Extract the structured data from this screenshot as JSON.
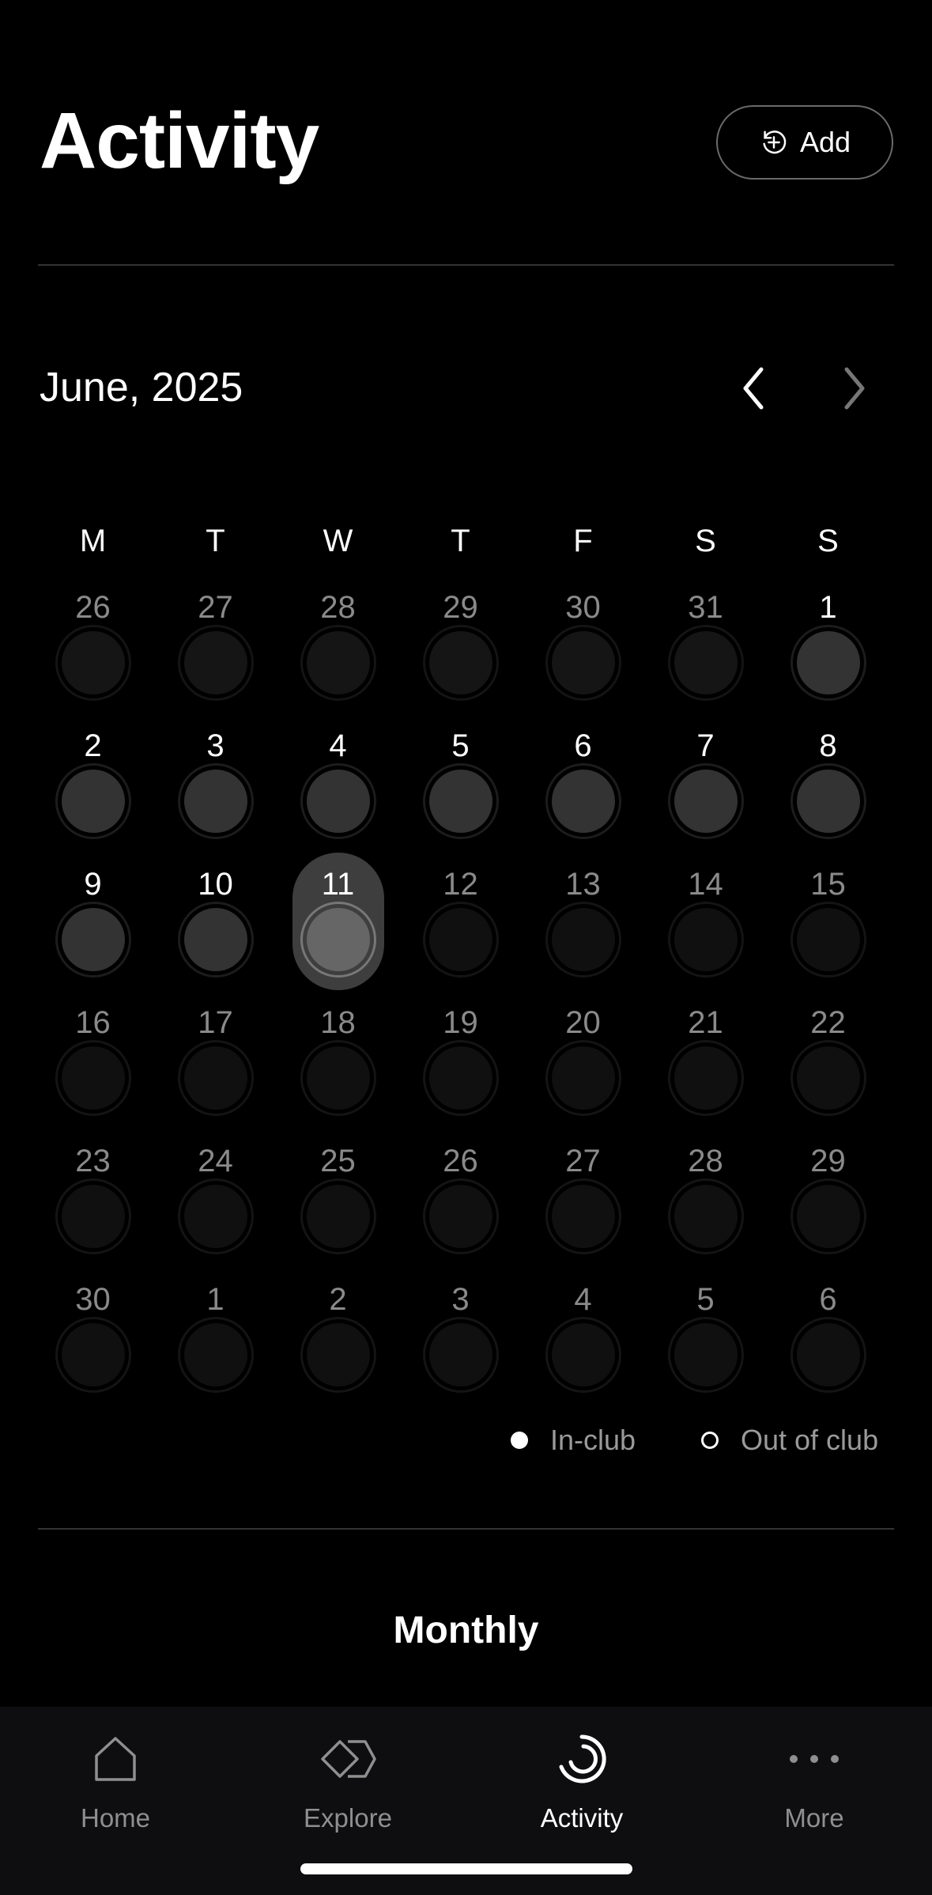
{
  "header": {
    "title": "Activity",
    "add_label": "Add"
  },
  "calendar": {
    "month_label": "June, 2025",
    "weekdays": [
      "M",
      "T",
      "W",
      "T",
      "F",
      "S",
      "S"
    ],
    "weeks": [
      [
        {
          "d": "26",
          "s": "dim"
        },
        {
          "d": "27",
          "s": "dim"
        },
        {
          "d": "28",
          "s": "dim"
        },
        {
          "d": "29",
          "s": "dim"
        },
        {
          "d": "30",
          "s": "dim"
        },
        {
          "d": "31",
          "s": "dim"
        },
        {
          "d": "1",
          "s": "cur"
        }
      ],
      [
        {
          "d": "2",
          "s": "cur"
        },
        {
          "d": "3",
          "s": "cur"
        },
        {
          "d": "4",
          "s": "cur"
        },
        {
          "d": "5",
          "s": "cur"
        },
        {
          "d": "6",
          "s": "cur"
        },
        {
          "d": "7",
          "s": "cur"
        },
        {
          "d": "8",
          "s": "cur"
        }
      ],
      [
        {
          "d": "9",
          "s": "cur"
        },
        {
          "d": "10",
          "s": "cur"
        },
        {
          "d": "11",
          "s": "today"
        },
        {
          "d": "12",
          "s": "fut"
        },
        {
          "d": "13",
          "s": "fut"
        },
        {
          "d": "14",
          "s": "fut"
        },
        {
          "d": "15",
          "s": "fut"
        }
      ],
      [
        {
          "d": "16",
          "s": "fut"
        },
        {
          "d": "17",
          "s": "fut"
        },
        {
          "d": "18",
          "s": "fut"
        },
        {
          "d": "19",
          "s": "fut"
        },
        {
          "d": "20",
          "s": "fut"
        },
        {
          "d": "21",
          "s": "fut"
        },
        {
          "d": "22",
          "s": "fut"
        }
      ],
      [
        {
          "d": "23",
          "s": "fut"
        },
        {
          "d": "24",
          "s": "fut"
        },
        {
          "d": "25",
          "s": "fut"
        },
        {
          "d": "26",
          "s": "fut"
        },
        {
          "d": "27",
          "s": "fut"
        },
        {
          "d": "28",
          "s": "fut"
        },
        {
          "d": "29",
          "s": "fut"
        }
      ],
      [
        {
          "d": "30",
          "s": "fut"
        },
        {
          "d": "1",
          "s": "fut"
        },
        {
          "d": "2",
          "s": "fut"
        },
        {
          "d": "3",
          "s": "fut"
        },
        {
          "d": "4",
          "s": "fut"
        },
        {
          "d": "5",
          "s": "fut"
        },
        {
          "d": "6",
          "s": "fut"
        }
      ]
    ]
  },
  "legend": {
    "in_club": "In-club",
    "out_of_club": "Out of club"
  },
  "section": {
    "title": "Monthly"
  },
  "tabs": [
    {
      "label": "Home",
      "icon": "home-icon",
      "active": false
    },
    {
      "label": "Explore",
      "icon": "explore-icon",
      "active": false
    },
    {
      "label": "Activity",
      "icon": "activity-icon",
      "active": true
    },
    {
      "label": "More",
      "icon": "more-icon",
      "active": false
    }
  ],
  "colors": {
    "background": "#000000",
    "tab_bar": "#0e0e10",
    "today_pill": "#3e3e3e"
  }
}
